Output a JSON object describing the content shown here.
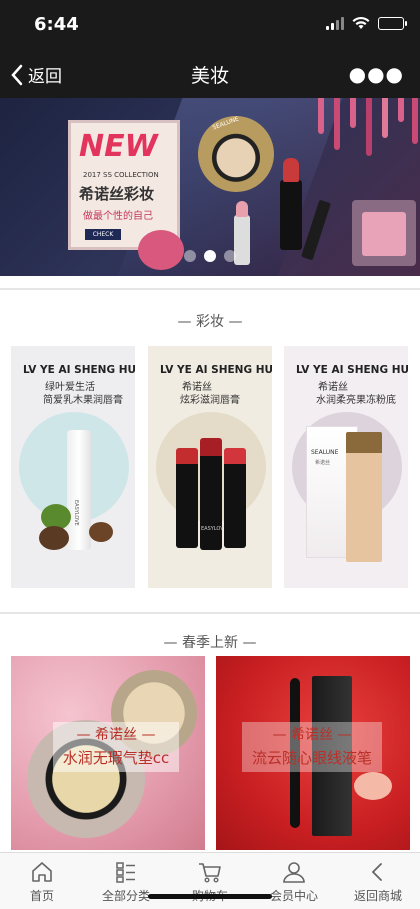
{
  "status_bar": {
    "time": "6:44"
  },
  "nav": {
    "back_label": "返回",
    "title": "美妆"
  },
  "banner": {
    "new_label": "NEW",
    "collection": "2017 SS COLLECTION",
    "brand": "希诺丝彩妆",
    "slogan": "做最个性的自己",
    "check": "CHECK",
    "product_brand": "SEALUNE",
    "active_slide": 2,
    "slide_count": 3
  },
  "section1": {
    "title": "— 彩妆 —"
  },
  "products": [
    {
      "head": "LV YE AI SHENG HUO",
      "sub1": "绿叶爱生活",
      "sub2": "简爱乳木果润唇膏",
      "bg": "#eeeef0",
      "circle": "#cfe6e8"
    },
    {
      "head": "LV YE AI SHENG HUO",
      "sub1": "希诺丝",
      "sub2": "炫彩滋润唇膏",
      "bg": "#f1ece2",
      "circle": "#e4dcc8"
    },
    {
      "head": "LV YE AI SHENG HUO",
      "sub1": "希诺丝",
      "sub2": "水润柔亮果冻粉底",
      "bg": "#f3eef2",
      "circle": "#ddd3dc"
    }
  ],
  "product_prints": {
    "lipbalm": "EASYLOVE",
    "lipstick": "EASYLOVE",
    "foundation_brand": "SEALUNE",
    "foundation_sub": "希诺丝"
  },
  "section2": {
    "title": "— 春季上新 —"
  },
  "new_arrivals": [
    {
      "line1": "— 希诺丝 —",
      "line2": "水润无瑕气垫cc"
    },
    {
      "line1": "— 希诺丝 —",
      "line2": "流云随心眼线液笔"
    }
  ],
  "tabs": [
    {
      "label": "首页",
      "icon": "home-icon"
    },
    {
      "label": "全部分类",
      "icon": "category-icon"
    },
    {
      "label": "购物车",
      "icon": "cart-icon"
    },
    {
      "label": "会员中心",
      "icon": "user-icon"
    },
    {
      "label": "返回商城",
      "icon": "back-icon"
    }
  ],
  "colors": {
    "bar": "#1a1a1a",
    "accent": "#e2345c",
    "battery": "#4cd964"
  }
}
